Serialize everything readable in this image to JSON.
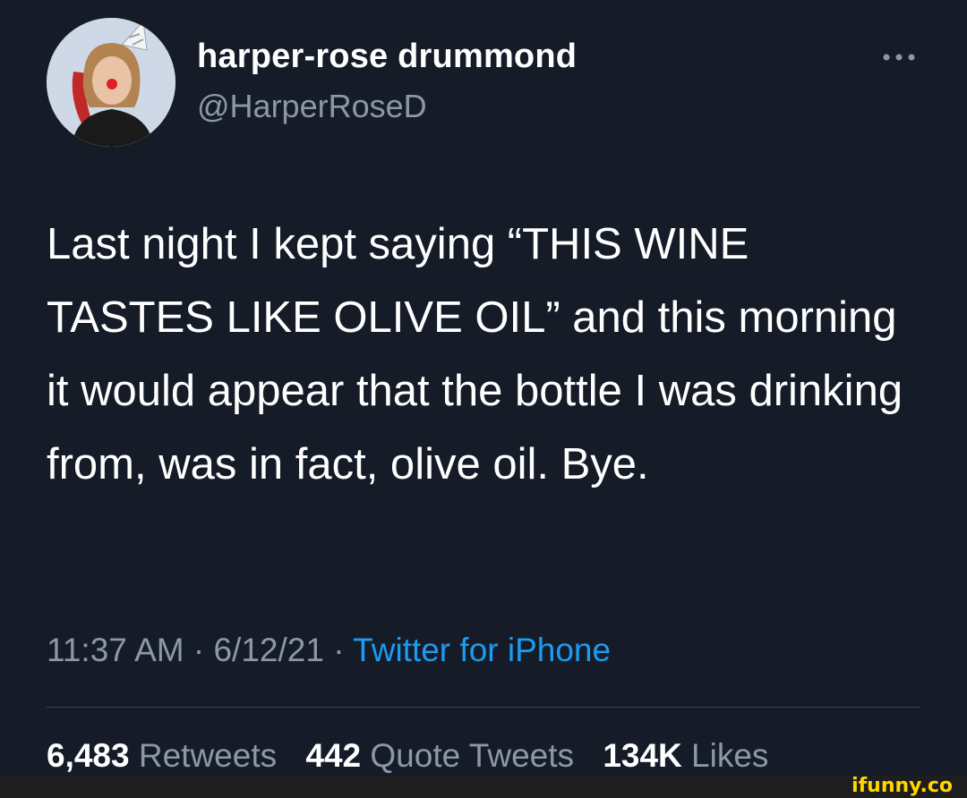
{
  "author": {
    "display_name": "harper-rose drummond",
    "handle": "@HarperRoseD",
    "avatar_icon": "profile-photo"
  },
  "more_icon": "ellipsis-icon",
  "tweet": {
    "text": "Last night I kept saying “THIS WINE TASTES LIKE OLIVE OIL” and this morning it would appear that the bottle I was drinking from, was in fact, olive oil. Bye."
  },
  "meta": {
    "time": "11:37 AM",
    "separator": "·",
    "date": "6/12/21",
    "source": "Twitter for iPhone"
  },
  "stats": {
    "retweets_count": "6,483",
    "retweets_label": "Retweets",
    "quotes_count": "442",
    "quotes_label": "Quote Tweets",
    "likes_count": "134K",
    "likes_label": "Likes"
  },
  "watermark": "ifunny.co",
  "colors": {
    "background": "#151c28",
    "secondary_text": "#8b98a5",
    "link": "#1d9bf0",
    "watermark": "#ffd600"
  }
}
